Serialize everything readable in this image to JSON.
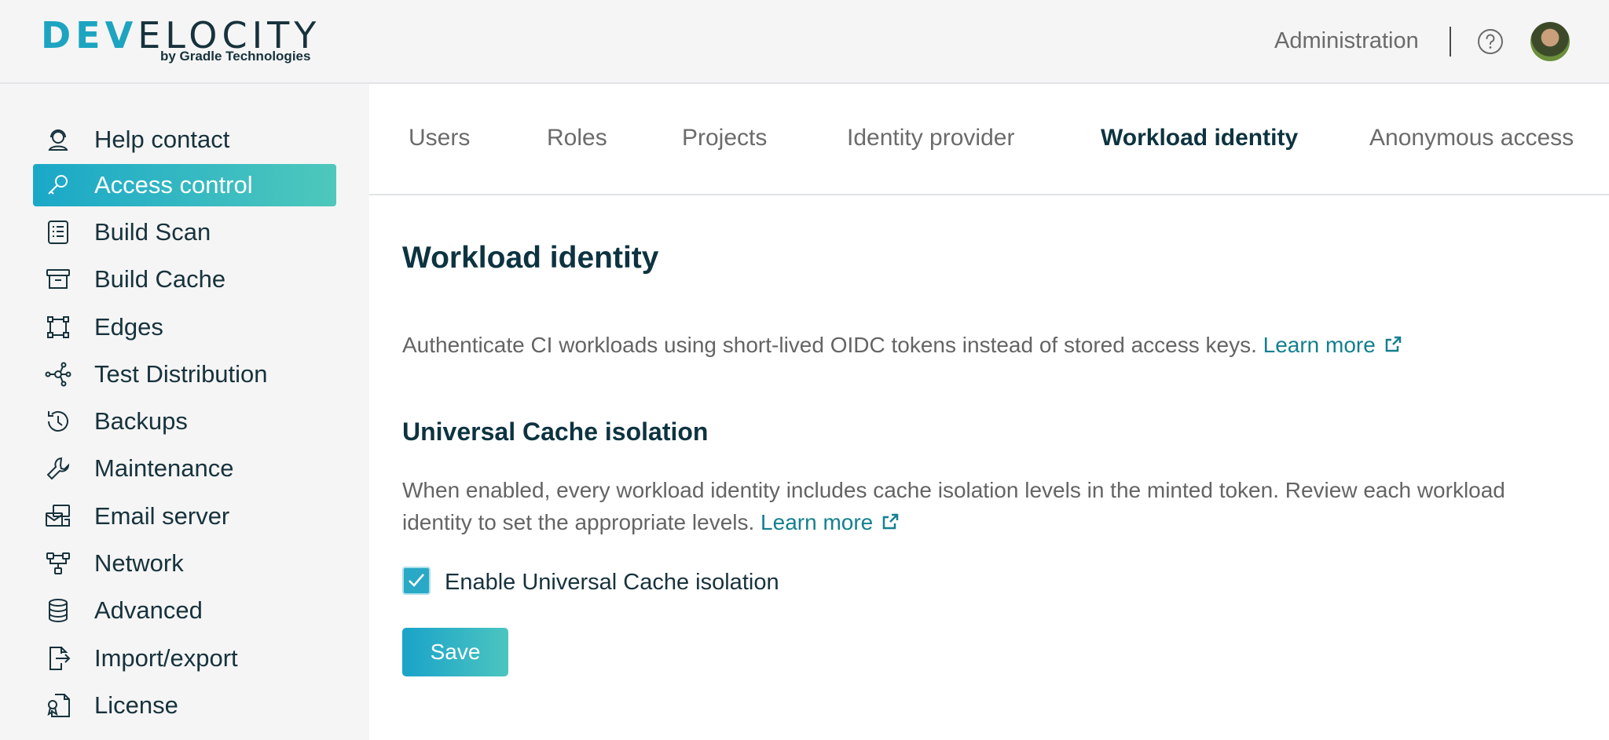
{
  "header": {
    "logo_dev": "DEV",
    "logo_rest": "ELOCITY",
    "logo_sub": "by Gradle Technologies",
    "admin_label": "Administration"
  },
  "sidebar": {
    "items": [
      {
        "label": "Help contact",
        "icon": "help-contact-icon"
      },
      {
        "label": "Access control",
        "icon": "key-icon",
        "active": true
      },
      {
        "label": "Build Scan",
        "icon": "list-icon"
      },
      {
        "label": "Build Cache",
        "icon": "archive-icon"
      },
      {
        "label": "Edges",
        "icon": "edges-icon"
      },
      {
        "label": "Test Distribution",
        "icon": "distribution-icon"
      },
      {
        "label": "Backups",
        "icon": "history-icon"
      },
      {
        "label": "Maintenance",
        "icon": "wrench-icon"
      },
      {
        "label": "Email server",
        "icon": "email-server-icon"
      },
      {
        "label": "Network",
        "icon": "network-icon"
      },
      {
        "label": "Advanced",
        "icon": "database-icon"
      },
      {
        "label": "Import/export",
        "icon": "export-icon"
      },
      {
        "label": "License",
        "icon": "license-icon"
      }
    ]
  },
  "tabs": [
    {
      "label": "Users"
    },
    {
      "label": "Roles"
    },
    {
      "label": "Projects"
    },
    {
      "label": "Identity provider"
    },
    {
      "label": "Workload identity",
      "active": true
    },
    {
      "label": "Anonymous access"
    }
  ],
  "main": {
    "title": "Workload identity",
    "description": "Authenticate CI workloads using short-lived OIDC tokens instead of stored access keys.",
    "learn_more": "Learn more",
    "section_title": "Universal Cache isolation",
    "section_description": "When enabled, every workload identity includes cache isolation levels in the minted token. Review each workload identity to set the appropriate levels.",
    "section_learn_more": "Learn more",
    "checkbox_label": "Enable Universal Cache isolation",
    "checkbox_checked": true,
    "save_label": "Save"
  },
  "colors": {
    "accent": "#1aa8c8",
    "link": "#14808f",
    "text": "#0d3340"
  }
}
